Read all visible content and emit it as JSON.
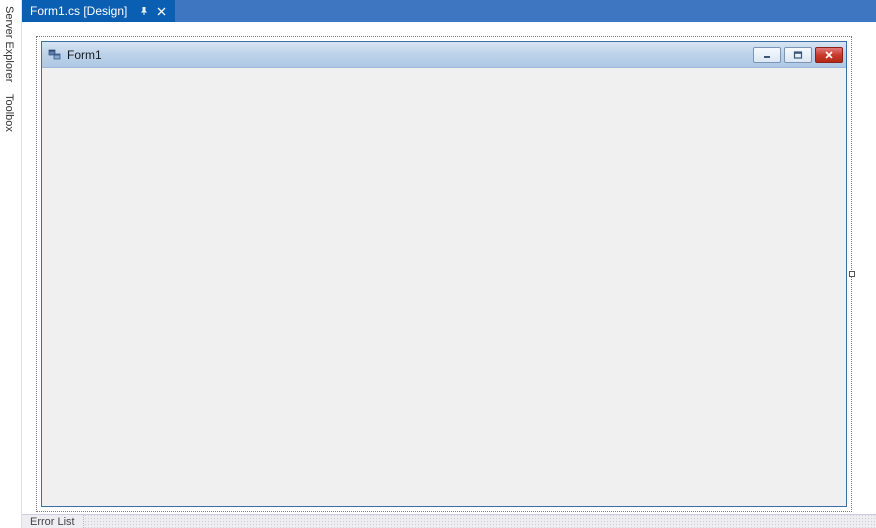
{
  "side_tabs": {
    "server_explorer": "Server Explorer",
    "toolbox": "Toolbox"
  },
  "tab": {
    "label": "Form1.cs [Design]"
  },
  "form": {
    "title": "Form1"
  },
  "bottom": {
    "error_list": "Error List"
  }
}
